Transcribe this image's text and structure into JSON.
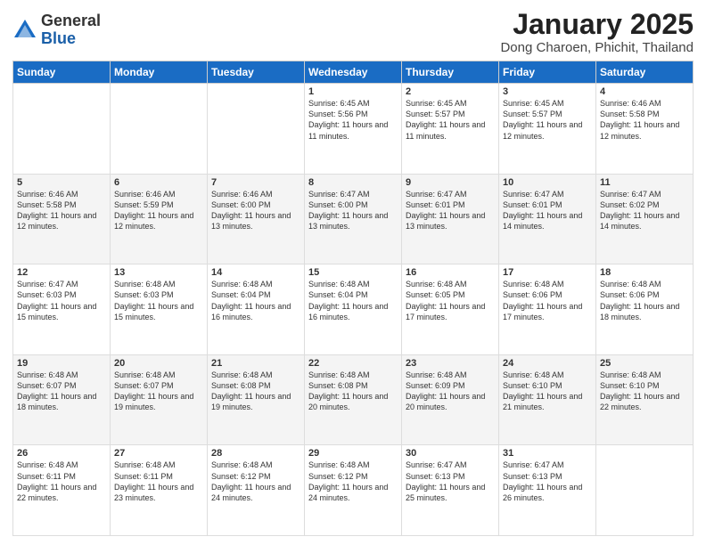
{
  "logo": {
    "general": "General",
    "blue": "Blue"
  },
  "title": "January 2025",
  "subtitle": "Dong Charoen, Phichit, Thailand",
  "days_of_week": [
    "Sunday",
    "Monday",
    "Tuesday",
    "Wednesday",
    "Thursday",
    "Friday",
    "Saturday"
  ],
  "weeks": [
    [
      {
        "day": "",
        "info": ""
      },
      {
        "day": "",
        "info": ""
      },
      {
        "day": "",
        "info": ""
      },
      {
        "day": "1",
        "info": "Sunrise: 6:45 AM\nSunset: 5:56 PM\nDaylight: 11 hours and 11 minutes."
      },
      {
        "day": "2",
        "info": "Sunrise: 6:45 AM\nSunset: 5:57 PM\nDaylight: 11 hours and 11 minutes."
      },
      {
        "day": "3",
        "info": "Sunrise: 6:45 AM\nSunset: 5:57 PM\nDaylight: 11 hours and 12 minutes."
      },
      {
        "day": "4",
        "info": "Sunrise: 6:46 AM\nSunset: 5:58 PM\nDaylight: 11 hours and 12 minutes."
      }
    ],
    [
      {
        "day": "5",
        "info": "Sunrise: 6:46 AM\nSunset: 5:58 PM\nDaylight: 11 hours and 12 minutes."
      },
      {
        "day": "6",
        "info": "Sunrise: 6:46 AM\nSunset: 5:59 PM\nDaylight: 11 hours and 12 minutes."
      },
      {
        "day": "7",
        "info": "Sunrise: 6:46 AM\nSunset: 6:00 PM\nDaylight: 11 hours and 13 minutes."
      },
      {
        "day": "8",
        "info": "Sunrise: 6:47 AM\nSunset: 6:00 PM\nDaylight: 11 hours and 13 minutes."
      },
      {
        "day": "9",
        "info": "Sunrise: 6:47 AM\nSunset: 6:01 PM\nDaylight: 11 hours and 13 minutes."
      },
      {
        "day": "10",
        "info": "Sunrise: 6:47 AM\nSunset: 6:01 PM\nDaylight: 11 hours and 14 minutes."
      },
      {
        "day": "11",
        "info": "Sunrise: 6:47 AM\nSunset: 6:02 PM\nDaylight: 11 hours and 14 minutes."
      }
    ],
    [
      {
        "day": "12",
        "info": "Sunrise: 6:47 AM\nSunset: 6:03 PM\nDaylight: 11 hours and 15 minutes."
      },
      {
        "day": "13",
        "info": "Sunrise: 6:48 AM\nSunset: 6:03 PM\nDaylight: 11 hours and 15 minutes."
      },
      {
        "day": "14",
        "info": "Sunrise: 6:48 AM\nSunset: 6:04 PM\nDaylight: 11 hours and 16 minutes."
      },
      {
        "day": "15",
        "info": "Sunrise: 6:48 AM\nSunset: 6:04 PM\nDaylight: 11 hours and 16 minutes."
      },
      {
        "day": "16",
        "info": "Sunrise: 6:48 AM\nSunset: 6:05 PM\nDaylight: 11 hours and 17 minutes."
      },
      {
        "day": "17",
        "info": "Sunrise: 6:48 AM\nSunset: 6:06 PM\nDaylight: 11 hours and 17 minutes."
      },
      {
        "day": "18",
        "info": "Sunrise: 6:48 AM\nSunset: 6:06 PM\nDaylight: 11 hours and 18 minutes."
      }
    ],
    [
      {
        "day": "19",
        "info": "Sunrise: 6:48 AM\nSunset: 6:07 PM\nDaylight: 11 hours and 18 minutes."
      },
      {
        "day": "20",
        "info": "Sunrise: 6:48 AM\nSunset: 6:07 PM\nDaylight: 11 hours and 19 minutes."
      },
      {
        "day": "21",
        "info": "Sunrise: 6:48 AM\nSunset: 6:08 PM\nDaylight: 11 hours and 19 minutes."
      },
      {
        "day": "22",
        "info": "Sunrise: 6:48 AM\nSunset: 6:08 PM\nDaylight: 11 hours and 20 minutes."
      },
      {
        "day": "23",
        "info": "Sunrise: 6:48 AM\nSunset: 6:09 PM\nDaylight: 11 hours and 20 minutes."
      },
      {
        "day": "24",
        "info": "Sunrise: 6:48 AM\nSunset: 6:10 PM\nDaylight: 11 hours and 21 minutes."
      },
      {
        "day": "25",
        "info": "Sunrise: 6:48 AM\nSunset: 6:10 PM\nDaylight: 11 hours and 22 minutes."
      }
    ],
    [
      {
        "day": "26",
        "info": "Sunrise: 6:48 AM\nSunset: 6:11 PM\nDaylight: 11 hours and 22 minutes."
      },
      {
        "day": "27",
        "info": "Sunrise: 6:48 AM\nSunset: 6:11 PM\nDaylight: 11 hours and 23 minutes."
      },
      {
        "day": "28",
        "info": "Sunrise: 6:48 AM\nSunset: 6:12 PM\nDaylight: 11 hours and 24 minutes."
      },
      {
        "day": "29",
        "info": "Sunrise: 6:48 AM\nSunset: 6:12 PM\nDaylight: 11 hours and 24 minutes."
      },
      {
        "day": "30",
        "info": "Sunrise: 6:47 AM\nSunset: 6:13 PM\nDaylight: 11 hours and 25 minutes."
      },
      {
        "day": "31",
        "info": "Sunrise: 6:47 AM\nSunset: 6:13 PM\nDaylight: 11 hours and 26 minutes."
      },
      {
        "day": "",
        "info": ""
      }
    ]
  ]
}
